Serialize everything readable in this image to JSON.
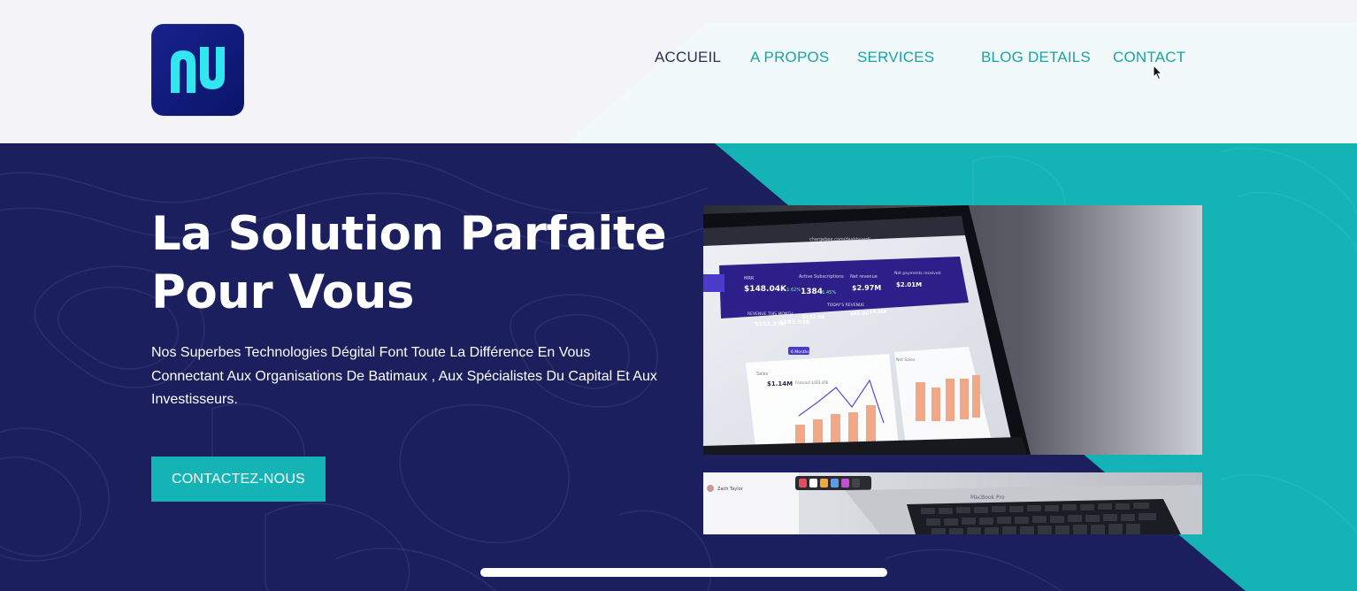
{
  "brand": {
    "logo_icon": "nu-logo-icon",
    "logo_bg": "#16208a",
    "logo_fg": "#31e6ee"
  },
  "nav": {
    "items": [
      {
        "label": "ACCUEIL",
        "active": true
      },
      {
        "label": "A PROPOS",
        "active": false
      },
      {
        "label": "SERVICES",
        "active": false
      },
      {
        "label": "BLOG DETAILS",
        "active": false
      },
      {
        "label": "CONTACT",
        "active": false
      }
    ]
  },
  "hero": {
    "title_line1": "La Solution Parfaite",
    "title_line2": "Pour Vous",
    "description": "Nos Superbes Technologies Dégital Font Toute La Différence En Vous Connectant Aux Organisations De Batimaux , Aux Spécialistes Du Capital Et Aux Investisseurs.",
    "cta_label": "CONTACTEZ-NOUS"
  },
  "dashboard_image": {
    "url_bar": "chargebee.com/dashboard/",
    "cards": [
      {
        "label": "MRR",
        "value": "$148.04K",
        "delta": "+1.62%"
      },
      {
        "label": "Active Subscriptions",
        "value": "1384",
        "delta": "+1.45%"
      },
      {
        "label": "Net revenue",
        "value": "$2.97M",
        "delta": ""
      },
      {
        "label": "Net payments received",
        "value": "$2.01M",
        "delta": ""
      }
    ],
    "revenue_label": "REVENUE THIS MONTH",
    "revenue_values": [
      "$153.27K",
      "$183.93K"
    ],
    "today_label": "TODAY'S REVENUE",
    "today_values": [
      "$102.9K",
      "$92.06",
      "$4.86K"
    ],
    "sales_label": "Sales",
    "sales_value": "$1.14M",
    "sales_forecast": "Forecast $183.45K",
    "churn_label": "Net Sales",
    "tab_label": "6 Months",
    "sidebar_user": "Zach Taylor",
    "keyboard_label": "MacBook Pro"
  },
  "colors": {
    "navy": "#1b1f5e",
    "teal": "#13b3b6",
    "nav_teal": "#1aa3a6",
    "header_bg": "#f4f3f8"
  }
}
